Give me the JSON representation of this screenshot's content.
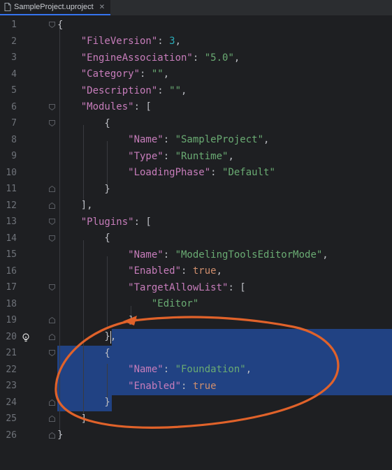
{
  "tab": {
    "label": "SampleProject.uproject"
  },
  "lines": [
    {
      "n": "1",
      "segs": [
        [
          "punc",
          "{"
        ]
      ]
    },
    {
      "n": "2",
      "segs": [
        [
          "key",
          "    \"FileVersion\""
        ],
        [
          "punc",
          ": "
        ],
        [
          "num",
          "3"
        ],
        [
          "punc",
          ","
        ]
      ]
    },
    {
      "n": "3",
      "segs": [
        [
          "key",
          "    \"EngineAssociation\""
        ],
        [
          "punc",
          ": "
        ],
        [
          "str",
          "\"5.0\""
        ],
        [
          "punc",
          ","
        ]
      ]
    },
    {
      "n": "4",
      "segs": [
        [
          "key",
          "    \"Category\""
        ],
        [
          "punc",
          ": "
        ],
        [
          "str",
          "\"\""
        ],
        [
          "punc",
          ","
        ]
      ]
    },
    {
      "n": "5",
      "segs": [
        [
          "key",
          "    \"Description\""
        ],
        [
          "punc",
          ": "
        ],
        [
          "str",
          "\"\""
        ],
        [
          "punc",
          ","
        ]
      ]
    },
    {
      "n": "6",
      "segs": [
        [
          "key",
          "    \"Modules\""
        ],
        [
          "punc",
          ": ["
        ]
      ]
    },
    {
      "n": "7",
      "segs": [
        [
          "punc",
          "        {"
        ]
      ]
    },
    {
      "n": "8",
      "segs": [
        [
          "key",
          "            \"Name\""
        ],
        [
          "punc",
          ": "
        ],
        [
          "str",
          "\"SampleProject\""
        ],
        [
          "punc",
          ","
        ]
      ]
    },
    {
      "n": "9",
      "segs": [
        [
          "key",
          "            \"Type\""
        ],
        [
          "punc",
          ": "
        ],
        [
          "str",
          "\"Runtime\""
        ],
        [
          "punc",
          ","
        ]
      ]
    },
    {
      "n": "10",
      "segs": [
        [
          "key",
          "            \"LoadingPhase\""
        ],
        [
          "punc",
          ": "
        ],
        [
          "str",
          "\"Default\""
        ]
      ]
    },
    {
      "n": "11",
      "segs": [
        [
          "punc",
          "        }"
        ]
      ]
    },
    {
      "n": "12",
      "segs": [
        [
          "punc",
          "    ],"
        ]
      ]
    },
    {
      "n": "13",
      "segs": [
        [
          "key",
          "    \"Plugins\""
        ],
        [
          "punc",
          ": ["
        ]
      ]
    },
    {
      "n": "14",
      "segs": [
        [
          "punc",
          "        {"
        ]
      ]
    },
    {
      "n": "15",
      "segs": [
        [
          "key",
          "            \"Name\""
        ],
        [
          "punc",
          ": "
        ],
        [
          "str",
          "\"ModelingToolsEditorMode\""
        ],
        [
          "punc",
          ","
        ]
      ]
    },
    {
      "n": "16",
      "segs": [
        [
          "key",
          "            \"Enabled\""
        ],
        [
          "punc",
          ": "
        ],
        [
          "kw",
          "true"
        ],
        [
          "punc",
          ","
        ]
      ]
    },
    {
      "n": "17",
      "segs": [
        [
          "key",
          "            \"TargetAllowList\""
        ],
        [
          "punc",
          ": ["
        ]
      ]
    },
    {
      "n": "18",
      "segs": [
        [
          "str",
          "                \"Editor\""
        ]
      ]
    },
    {
      "n": "19",
      "segs": [
        [
          "punc",
          "            ]"
        ]
      ]
    },
    {
      "n": "20",
      "segs": [
        [
          "punc",
          "        },"
        ]
      ]
    },
    {
      "n": "21",
      "segs": [
        [
          "punc",
          "        {"
        ]
      ]
    },
    {
      "n": "22",
      "segs": [
        [
          "key",
          "            \"Name\""
        ],
        [
          "punc",
          ": "
        ],
        [
          "str",
          "\"Foundation\""
        ],
        [
          "punc",
          ","
        ]
      ]
    },
    {
      "n": "23",
      "segs": [
        [
          "key",
          "            \"Enabled\""
        ],
        [
          "punc",
          ": "
        ],
        [
          "kw",
          "true"
        ]
      ]
    },
    {
      "n": "24",
      "segs": [
        [
          "punc",
          "        }"
        ]
      ]
    },
    {
      "n": "25",
      "segs": [
        [
          "punc",
          "    ]"
        ]
      ]
    },
    {
      "n": "26",
      "segs": [
        [
          "punc",
          "}"
        ]
      ]
    }
  ],
  "colors": {
    "background": "#1e1f22",
    "selection": "#214283",
    "annotation": "#e0622a",
    "key": "#c77dbb",
    "string": "#6aab73",
    "number": "#2aacb8",
    "keyword": "#cf8e6d"
  }
}
